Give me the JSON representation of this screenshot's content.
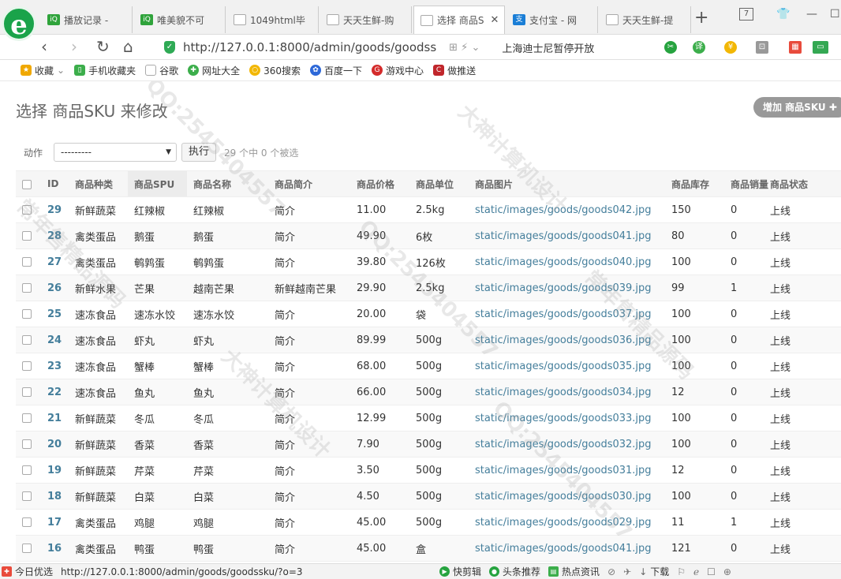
{
  "browser": {
    "tabs": [
      {
        "label": "播放记录 -",
        "icon": "iqiyi-icon",
        "color": "#2fa33b"
      },
      {
        "label": "唯美貌不可",
        "icon": "iqiyi-icon",
        "color": "#2fa33b"
      },
      {
        "label": "1049html毕",
        "icon": "page-icon",
        "color": "#ffffff"
      },
      {
        "label": "天天生鲜-购",
        "icon": "page-icon",
        "color": "#ffffff"
      },
      {
        "label": "选择 商品S",
        "icon": "page-icon",
        "color": "#ffffff",
        "active": true
      },
      {
        "label": "支付宝 - 网",
        "icon": "alipay-icon",
        "color": "#1a7ed6"
      },
      {
        "label": "天天生鲜-提",
        "icon": "page-icon",
        "color": "#ffffff"
      }
    ],
    "tab_counter": "7",
    "url": "http://127.0.0.1:8000/admin/goods/goodss",
    "url_host": "127.0.0.1",
    "search_suggestion": "上海迪士尼暂停开放",
    "bookmarks": [
      {
        "label": "收藏",
        "icon": "star-icon",
        "color": "#f0a800"
      },
      {
        "label": "手机收藏夹",
        "icon": "phone-icon",
        "color": "#3cae4b"
      },
      {
        "label": "谷歌",
        "icon": "page-icon",
        "color": "#bbbbbb"
      },
      {
        "label": "网址大全",
        "icon": "globe-icon",
        "color": "#3cae4b"
      },
      {
        "label": "360搜索",
        "icon": "search-360-icon",
        "color": "#f2b705"
      },
      {
        "label": "百度一下",
        "icon": "baidu-paw-icon",
        "color": "#2d68d8"
      },
      {
        "label": "游戏中心",
        "icon": "game-icon",
        "color": "#d42b2b"
      },
      {
        "label": "做推送",
        "icon": "push-icon",
        "color": "#c0262b"
      }
    ]
  },
  "page": {
    "title": "选择 商品SKU 来修改",
    "add_button": "增加 商品SKU ✚",
    "action_label": "动作",
    "action_select": "---------",
    "run_button": "执行",
    "counter": "29 个中 0 个被选"
  },
  "table": {
    "headers": [
      "",
      "ID",
      "商品种类",
      "商品SPU",
      "商品名称",
      "商品简介",
      "商品价格",
      "商品单位",
      "商品图片",
      "商品库存",
      "商品销量",
      "商品状态"
    ],
    "rows": [
      [
        "29",
        "新鲜蔬菜",
        "红辣椒",
        "红辣椒",
        "简介",
        "11.00",
        "2.5kg",
        "static/images/goods/goods042.jpg",
        "150",
        "0",
        "上线"
      ],
      [
        "28",
        "禽类蛋品",
        "鹅蛋",
        "鹅蛋",
        "简介",
        "49.90",
        "6枚",
        "static/images/goods/goods041.jpg",
        "80",
        "0",
        "上线"
      ],
      [
        "27",
        "禽类蛋品",
        "鹌鹑蛋",
        "鹌鹑蛋",
        "简介",
        "39.80",
        "126枚",
        "static/images/goods/goods040.jpg",
        "100",
        "0",
        "上线"
      ],
      [
        "26",
        "新鲜水果",
        "芒果",
        "越南芒果",
        "新鲜越南芒果",
        "29.90",
        "2.5kg",
        "static/images/goods/goods039.jpg",
        "99",
        "1",
        "上线"
      ],
      [
        "25",
        "速冻食品",
        "速冻水饺",
        "速冻水饺",
        "简介",
        "20.00",
        "袋",
        "static/images/goods/goods037.jpg",
        "100",
        "0",
        "上线"
      ],
      [
        "24",
        "速冻食品",
        "虾丸",
        "虾丸",
        "简介",
        "89.99",
        "500g",
        "static/images/goods/goods036.jpg",
        "100",
        "0",
        "上线"
      ],
      [
        "23",
        "速冻食品",
        "蟹棒",
        "蟹棒",
        "简介",
        "68.00",
        "500g",
        "static/images/goods/goods035.jpg",
        "100",
        "0",
        "上线"
      ],
      [
        "22",
        "速冻食品",
        "鱼丸",
        "鱼丸",
        "简介",
        "66.00",
        "500g",
        "static/images/goods/goods034.jpg",
        "12",
        "0",
        "上线"
      ],
      [
        "21",
        "新鲜蔬菜",
        "冬瓜",
        "冬瓜",
        "简介",
        "12.99",
        "500g",
        "static/images/goods/goods033.jpg",
        "100",
        "0",
        "上线"
      ],
      [
        "20",
        "新鲜蔬菜",
        "香菜",
        "香菜",
        "简介",
        "7.90",
        "500g",
        "static/images/goods/goods032.jpg",
        "100",
        "0",
        "上线"
      ],
      [
        "19",
        "新鲜蔬菜",
        "芹菜",
        "芹菜",
        "简介",
        "3.50",
        "500g",
        "static/images/goods/goods031.jpg",
        "12",
        "0",
        "上线"
      ],
      [
        "18",
        "新鲜蔬菜",
        "白菜",
        "白菜",
        "简介",
        "4.50",
        "500g",
        "static/images/goods/goods030.jpg",
        "100",
        "0",
        "上线"
      ],
      [
        "17",
        "禽类蛋品",
        "鸡腿",
        "鸡腿",
        "简介",
        "45.00",
        "500g",
        "static/images/goods/goods029.jpg",
        "11",
        "1",
        "上线"
      ],
      [
        "16",
        "禽类蛋品",
        "鸭蛋",
        "鸭蛋",
        "简介",
        "45.00",
        "盒",
        "static/images/goods/goods041.jpg",
        "121",
        "0",
        "上线"
      ]
    ]
  },
  "statusbar": {
    "left_label": "今日优选",
    "link_url": "http://127.0.0.1:8000/admin/goods/goodssku/?o=3",
    "items": [
      "快剪辑",
      "头条推荐",
      "热点资讯",
      "下载"
    ]
  },
  "watermarks": [
    "QQ:2545404557",
    "大神计算机设计",
    "常年售精品源码"
  ],
  "colors": {
    "link": "#447e9b",
    "add_button": "#999999",
    "browser_green": "#1aa34a"
  }
}
